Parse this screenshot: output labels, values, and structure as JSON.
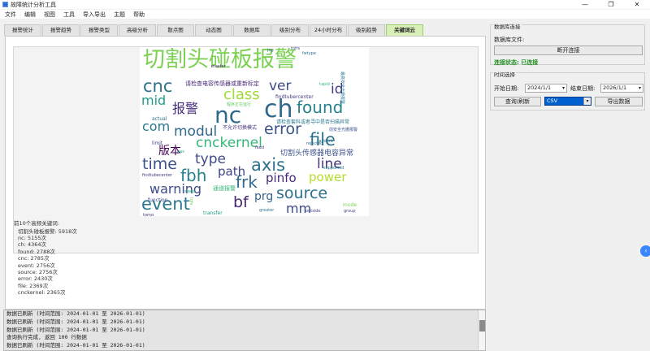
{
  "window": {
    "title": "故障统计分析工具",
    "controls": [
      "—",
      "❐",
      "✕"
    ]
  },
  "menu": [
    "文件",
    "编辑",
    "视图",
    "工具",
    "导入导出",
    "主题",
    "帮助"
  ],
  "tabs": [
    {
      "label": "报警统计",
      "active": false
    },
    {
      "label": "报警趋势",
      "active": false
    },
    {
      "label": "报警类型",
      "active": false
    },
    {
      "label": "高级分析",
      "active": false
    },
    {
      "label": "散点图",
      "active": false
    },
    {
      "label": "动态图",
      "active": false
    },
    {
      "label": "数据库",
      "active": false
    },
    {
      "label": "级别分布",
      "active": false
    },
    {
      "label": "24小时分布",
      "active": false
    },
    {
      "label": "级别趋势",
      "active": false
    },
    {
      "label": "关键词云",
      "active": true
    }
  ],
  "wordcloud": {
    "words": [
      {
        "text": "切割头碰板报警",
        "color": "#7ad151"
      },
      {
        "text": "nc",
        "color": "#31688e"
      },
      {
        "text": "ch",
        "color": "#31688e"
      },
      {
        "text": "found",
        "color": "#26828e"
      },
      {
        "text": "cnc",
        "color": "#2c728e"
      },
      {
        "text": "event",
        "color": "#2a788e"
      },
      {
        "text": "source",
        "color": "#2c728e"
      },
      {
        "text": "error",
        "color": "#3b528b"
      },
      {
        "text": "file",
        "color": "#2d708e"
      },
      {
        "text": "cnckernel",
        "color": "#35b779"
      },
      {
        "text": "mid",
        "color": "#1f9e89"
      },
      {
        "text": "class",
        "color": "#a0da39"
      },
      {
        "text": "ver",
        "color": "#3e4a89"
      },
      {
        "text": "报警",
        "color": "#472d7b"
      },
      {
        "text": "com",
        "color": "#2a788e"
      },
      {
        "text": "modul",
        "color": "#31688e"
      },
      {
        "text": "time",
        "color": "#3b528b"
      },
      {
        "text": "type",
        "color": "#3e4a89"
      },
      {
        "text": "版本",
        "color": "#440154"
      },
      {
        "text": "fbh",
        "color": "#26828e"
      },
      {
        "text": "path",
        "color": "#414487"
      },
      {
        "text": "axis",
        "color": "#2c728e"
      },
      {
        "text": "pinfo",
        "color": "#482878"
      },
      {
        "text": "line",
        "color": "#46327e"
      },
      {
        "text": "power",
        "color": "#b5de2b"
      },
      {
        "text": "warning",
        "color": "#3e4a89"
      },
      {
        "text": "frk",
        "color": "#31688e"
      },
      {
        "text": "prg",
        "color": "#33638d"
      },
      {
        "text": "bf",
        "color": "#482878"
      },
      {
        "text": "mm",
        "color": "#3e4a89"
      },
      {
        "text": "id",
        "color": "#443983"
      },
      {
        "text": "切割头传感器电容异常",
        "color": "#3b528b"
      },
      {
        "text": "请检查电容传感器或重新标定",
        "color": "#482878"
      },
      {
        "text": "请检查套料或者寻中是否扫描异常",
        "color": "#2a788e"
      },
      {
        "text": "通道报警",
        "color": "#35b779"
      },
      {
        "text": "不允许切换模式",
        "color": "#46327e"
      },
      {
        "text": "程序正在运行",
        "color": "#5ec962"
      },
      {
        "text": "findtubercenter",
        "color": "#443983"
      },
      {
        "text": "最高安全光栅报警",
        "color": "#2a788e"
      },
      {
        "text": "前安全光栅报警",
        "color": "#3b528b"
      },
      {
        "text": "gas",
        "color": "#22a884"
      },
      {
        "text": "limit",
        "color": "#3e4a89"
      },
      {
        "text": "actual",
        "color": "#2c728e"
      },
      {
        "text": "function",
        "color": "#414487"
      },
      {
        "text": "transfer",
        "color": "#1f9e89"
      },
      {
        "text": "tofs",
        "color": "#6ece58"
      },
      {
        "text": "master",
        "color": "#482878"
      },
      {
        "text": "greater",
        "color": "#2a788e"
      },
      {
        "text": "group",
        "color": "#3e4a89"
      },
      {
        "text": "supported",
        "color": "#26828e"
      },
      {
        "text": "rejected",
        "color": "#2c728e"
      },
      {
        "text": "outside",
        "color": "#414487"
      },
      {
        "text": "mode",
        "color": "#7ad151"
      },
      {
        "text": "tomg",
        "color": "#46327e"
      },
      {
        "text": "jog",
        "color": "#31688e"
      },
      {
        "text": "toffs",
        "color": "#3b528b"
      },
      {
        "text": "fwtype",
        "color": "#2c728e"
      },
      {
        "text": "findtubecenter",
        "color": "#443983"
      },
      {
        "text": "sleep",
        "color": "#22a884"
      },
      {
        "text": "feed",
        "color": "#46327e"
      },
      {
        "text": "tapid",
        "color": "#35b779"
      },
      {
        "text": "ladderb",
        "color": "#2a788e"
      }
    ]
  },
  "keywords": {
    "heading": "前10个高频关键词:",
    "items": [
      "切割头碰板报警: 5918次",
      "nc: 5155次",
      "ch: 4364次",
      "found: 2788次",
      "cnc: 2785次",
      "event: 2756次",
      "source: 2756次",
      "error: 2430次",
      "file: 2369次",
      "cnckernel: 2365次"
    ]
  },
  "log": {
    "lines": [
      "数据已刷新 (时间范围: 2024-01-01 至 2026-01-01)",
      "数据已刷新 (时间范围: 2024-01-01 至 2026-01-01)",
      "数据已刷新 (时间范围: 2024-01-01 至 2026-01-01)",
      "查询执行完成, 返回 100 行数据",
      "数据已刷新 (时间范围: 2024-01-01 至 2026-01-01)"
    ]
  },
  "db": {
    "group_title": "数据库连接",
    "file_label": "数据库文件:",
    "disconnect_button": "断开连接",
    "status": "连接状态: 已连接"
  },
  "time": {
    "group_title": "时间选择",
    "start_label": "开始日期:",
    "start_value": "2024/1/1",
    "end_label": "结束日期:",
    "end_value": "2026/1/1",
    "query_button": "查询/刷新",
    "format_value": "CSV",
    "export_button": "导出数据"
  }
}
